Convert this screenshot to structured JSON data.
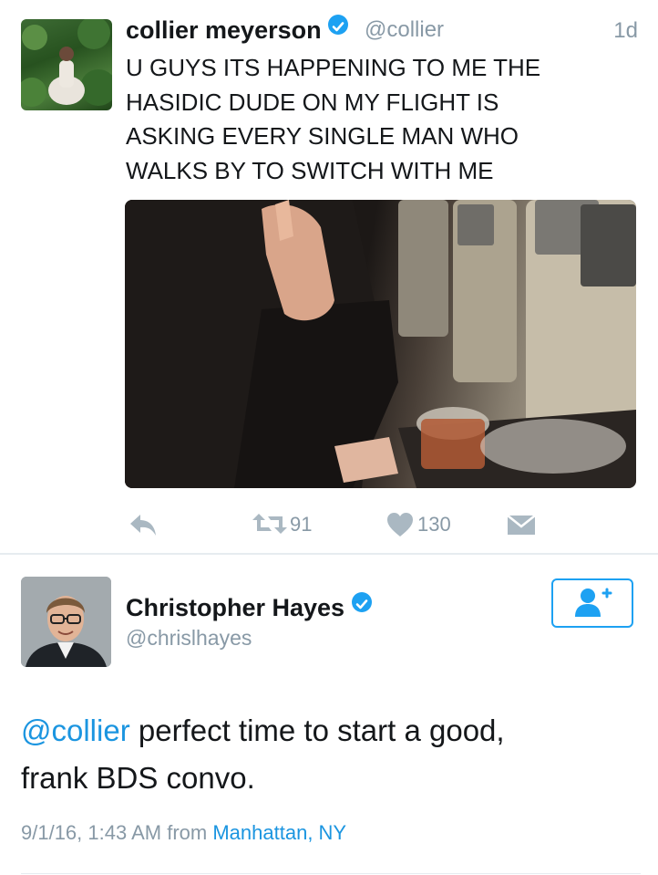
{
  "tweet1": {
    "author_name": "collier meyerson",
    "handle": "@collier",
    "time": "1d",
    "lines": [
      "U GUYS ITS HAPPENING TO ME THE",
      "HASIDIC DUDE ON MY FLIGHT IS",
      "ASKING EVERY SINGLE MAN WHO",
      "WALKS BY TO SWITCH WITH ME"
    ],
    "retweet_count": "91",
    "like_count": "130"
  },
  "tweet2": {
    "author_name": "Christopher Hayes",
    "handle": "@chrislhayes",
    "mention": "@collier",
    "text_line1_rest": " perfect time to start a good,",
    "text_line2": "frank BDS convo.",
    "timestamp": "9/1/16, 1:43 AM from",
    "location": "Manhattan, NY"
  },
  "colors": {
    "link_blue": "#1b95e0",
    "verified_blue": "#1da1f2",
    "muted_gray": "#8899a6",
    "icon_gray": "#aab8c2"
  }
}
